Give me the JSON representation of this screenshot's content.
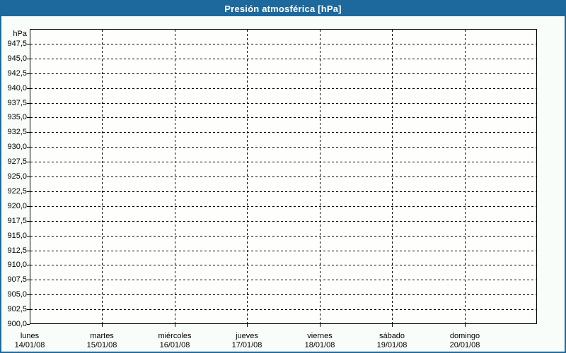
{
  "title_bar": {
    "title": "Presión atmosférica [hPa]"
  },
  "y_axis": {
    "unit_label": "hPa",
    "min": 900,
    "max": 950,
    "tick_step": 2.5,
    "tick_labels": [
      "947,5",
      "945,0",
      "942,5",
      "940,0",
      "937,5",
      "935,0",
      "932,5",
      "930,0",
      "927,5",
      "925,0",
      "922,5",
      "920,0",
      "917,5",
      "915,0",
      "912,5",
      "910,0",
      "907,5",
      "905,0",
      "902,5",
      "900,0"
    ]
  },
  "x_axis": {
    "num_day_columns": 7,
    "days": [
      {
        "name": "lunes",
        "date": "14/01/08"
      },
      {
        "name": "martes",
        "date": "15/01/08"
      },
      {
        "name": "miércoles",
        "date": "16/01/08"
      },
      {
        "name": "jueves",
        "date": "17/01/08"
      },
      {
        "name": "viernes",
        "date": "18/01/08"
      },
      {
        "name": "sábado",
        "date": "19/01/08"
      },
      {
        "name": "domingo",
        "date": "20/01/08"
      }
    ]
  },
  "colors": {
    "title_bar_bg": "#1d699e",
    "frame": "#1d699e",
    "title_text": "#ffffff",
    "grid": "#000000",
    "text": "#000000",
    "background": "#f9fdf9",
    "plot_background": "#fefffc"
  },
  "chart_data": {
    "type": "line",
    "title": "Presión atmosférica [hPa]",
    "xlabel": "",
    "ylabel": "hPa",
    "ylim": [
      900,
      950
    ],
    "ytick_step": 2.5,
    "grid": true,
    "legend_position": "none",
    "x_categories": [
      "lunes 14/01/08",
      "martes 15/01/08",
      "miércoles 16/01/08",
      "jueves 17/01/08",
      "viernes 18/01/08",
      "sábado 19/01/08",
      "domingo 20/01/08"
    ],
    "series": []
  }
}
